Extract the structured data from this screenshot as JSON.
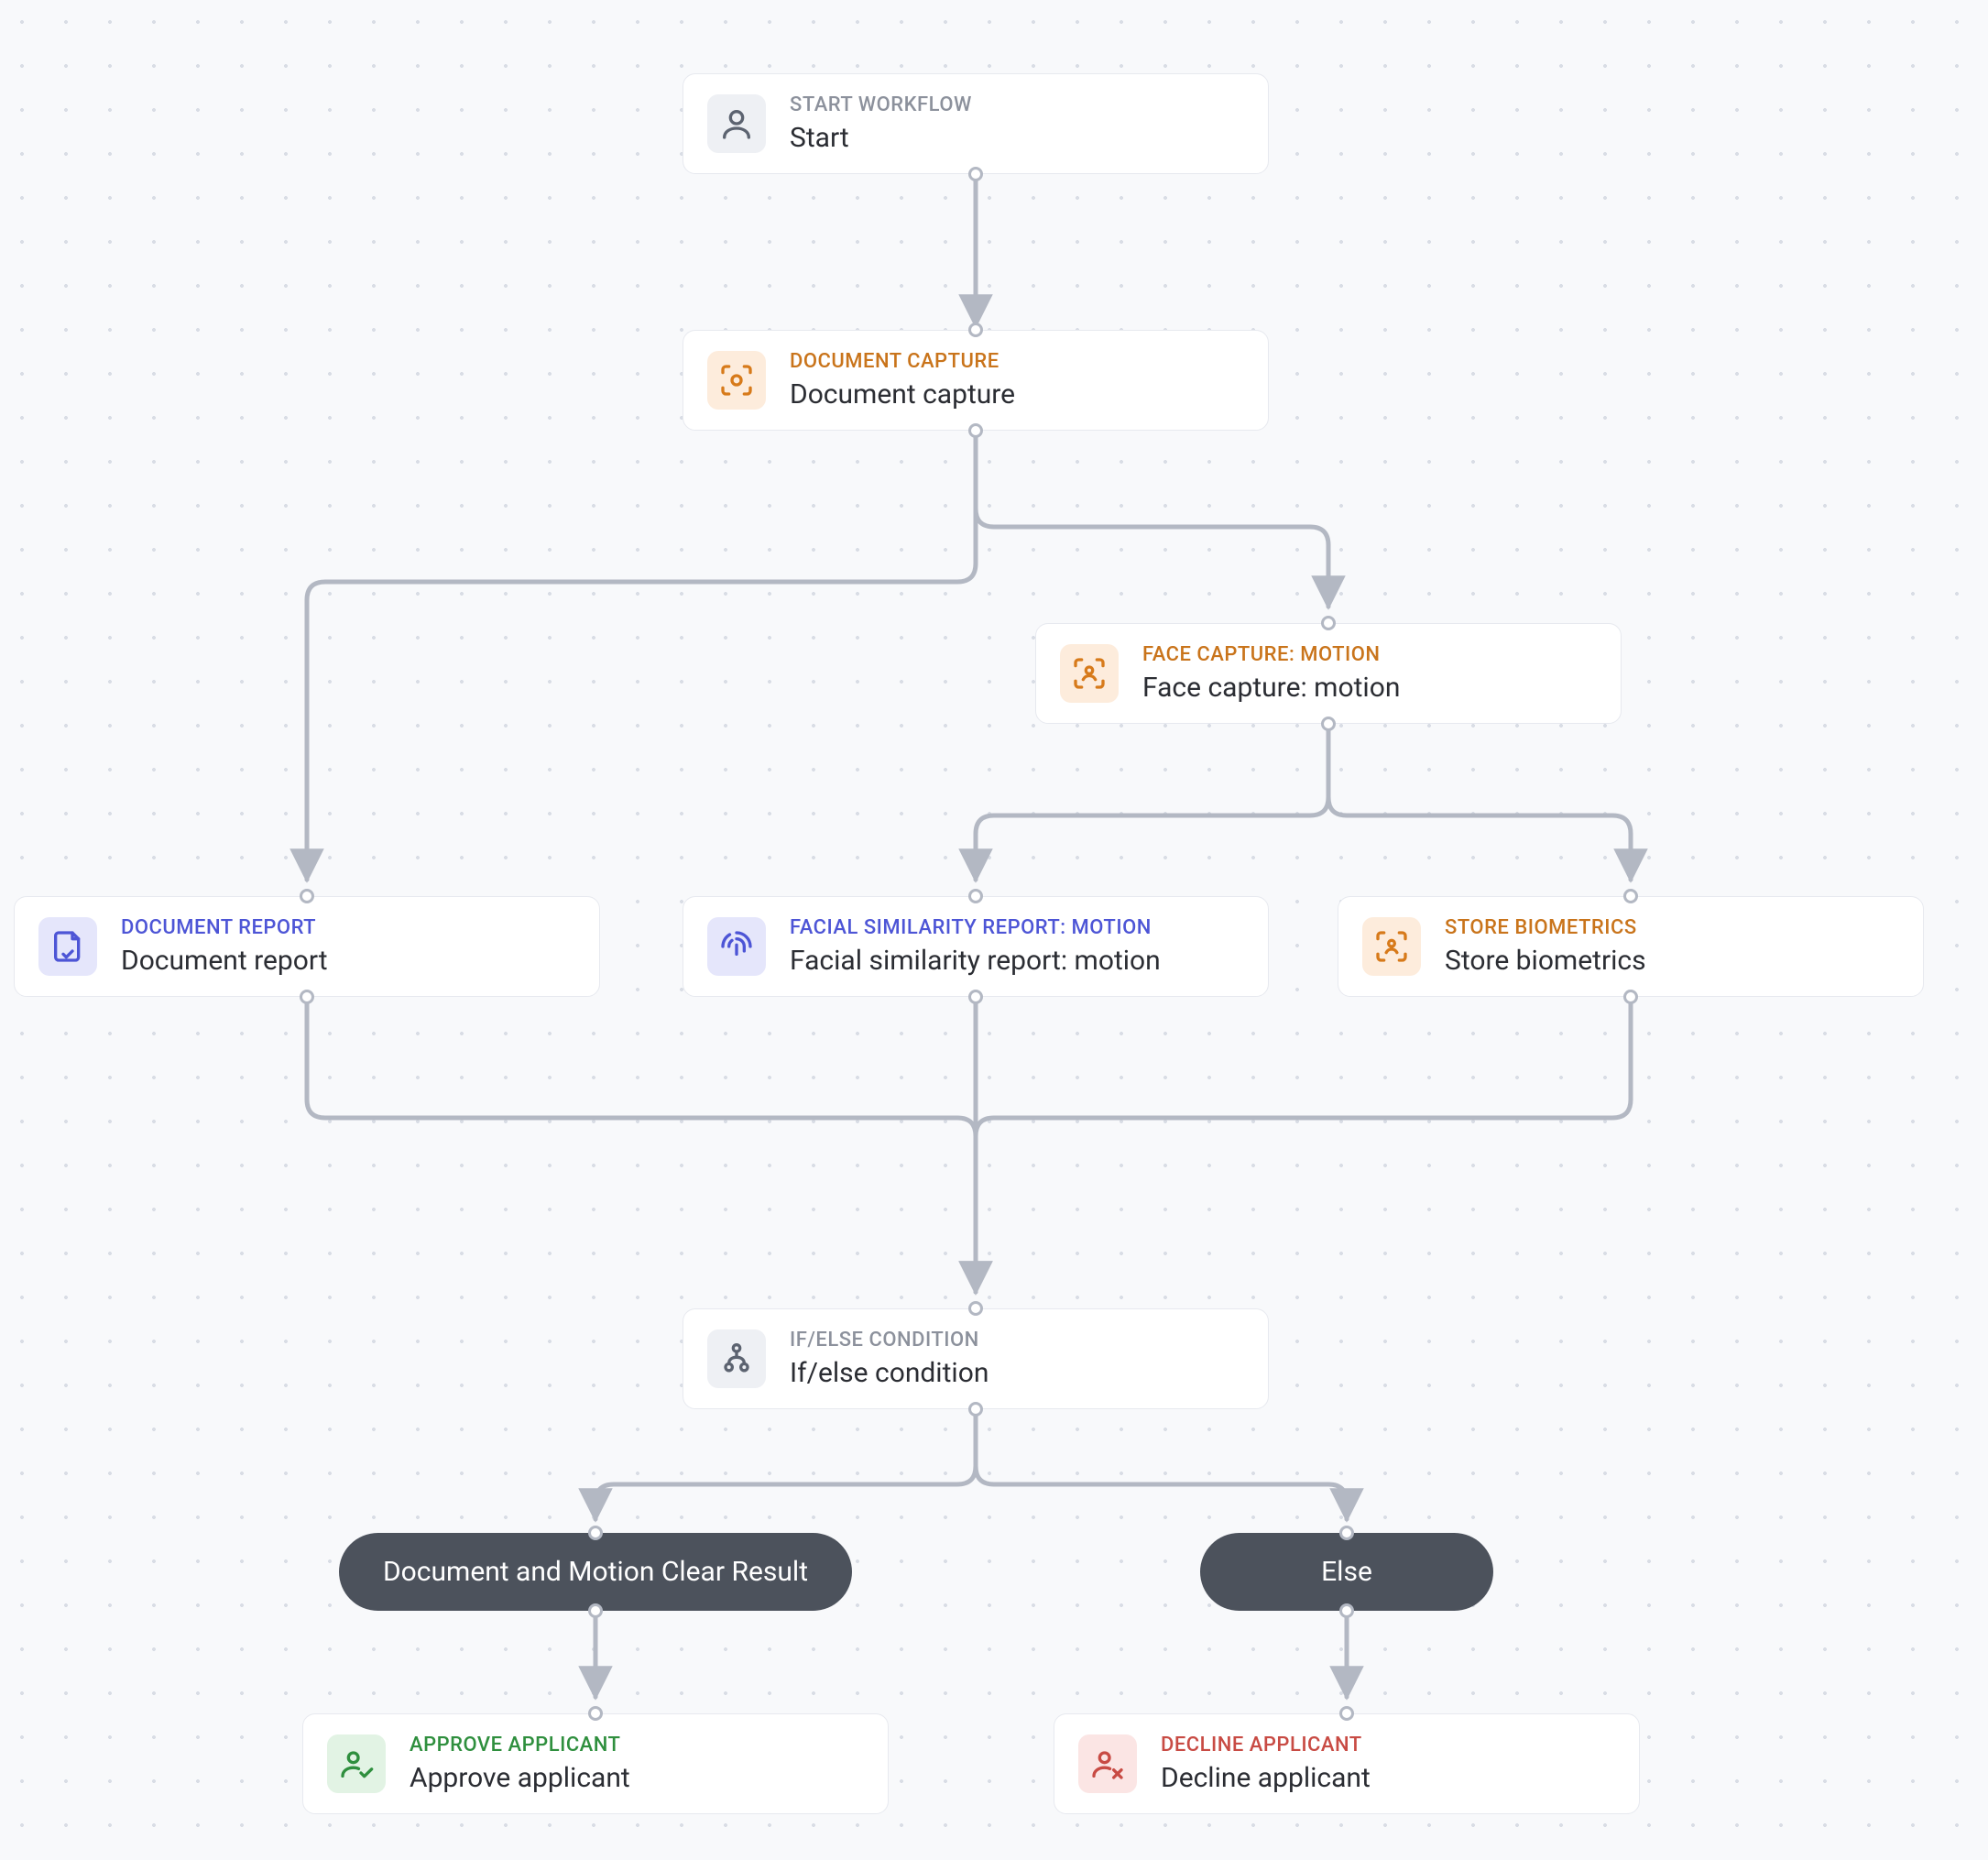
{
  "nodes": {
    "start": {
      "caption": "START WORKFLOW",
      "label": "Start"
    },
    "doccap": {
      "caption": "DOCUMENT CAPTURE",
      "label": "Document capture"
    },
    "facecap": {
      "caption": "FACE CAPTURE: MOTION",
      "label": "Face capture: motion"
    },
    "docreport": {
      "caption": "DOCUMENT REPORT",
      "label": "Document report"
    },
    "facerep": {
      "caption": "FACIAL SIMILARITY REPORT: MOTION",
      "label": "Facial similarity report: motion"
    },
    "storebio": {
      "caption": "STORE BIOMETRICS",
      "label": "Store biometrics"
    },
    "ifelse": {
      "caption": "IF/ELSE CONDITION",
      "label": "If/else condition"
    },
    "approve": {
      "caption": "APPROVE APPLICANT",
      "label": "Approve applicant"
    },
    "decline": {
      "caption": "DECLINE APPLICANT",
      "label": "Decline applicant"
    }
  },
  "branches": {
    "clear": "Document and Motion Clear Result",
    "else": "Else"
  },
  "colors": {
    "edge": "#b3b8c3",
    "arrow": "#b3b8c3"
  }
}
